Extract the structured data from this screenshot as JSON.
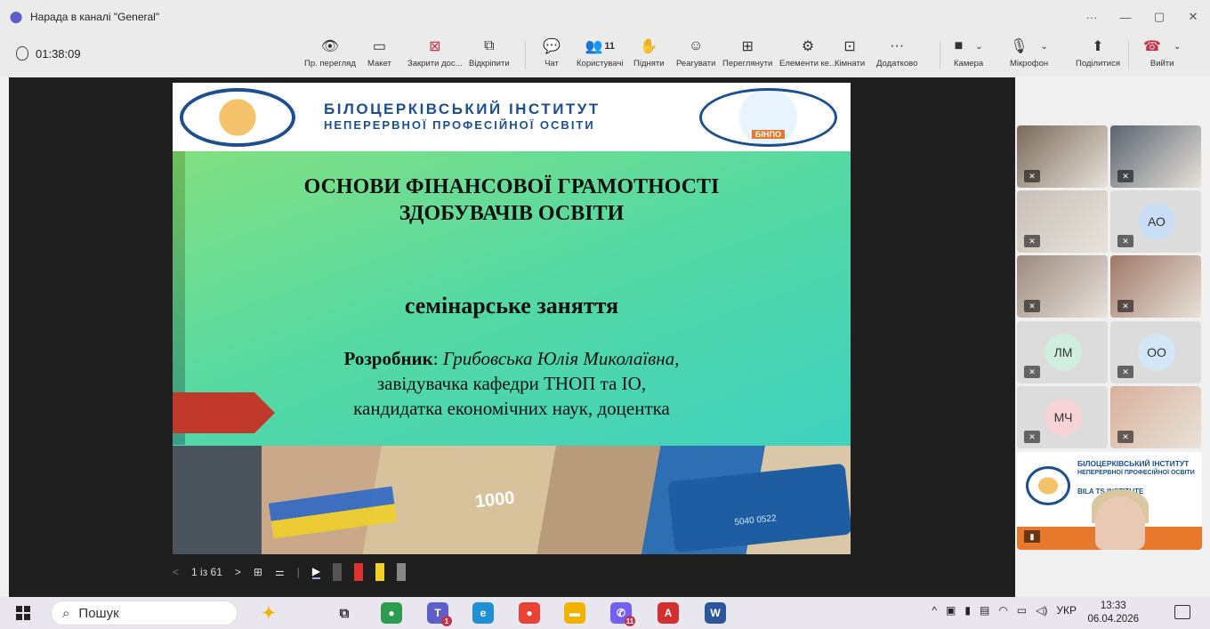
{
  "window": {
    "title": "Нарада в каналі \"General\"",
    "controls": [
      "···",
      "—",
      "▢",
      "✕"
    ]
  },
  "meeting": {
    "timer": "01:38:09"
  },
  "toolbar": {
    "items": [
      {
        "label": "Пр. перегляд",
        "icon": "👁"
      },
      {
        "label": "Макет",
        "icon": "▭"
      },
      {
        "label": "Закрити дос...",
        "icon": "⊠"
      },
      {
        "label": "Відкріпити",
        "icon": "⧉"
      },
      {
        "label": "Чат",
        "icon": "💬"
      },
      {
        "label": "Користувачі",
        "icon": "👥",
        "badge": "11"
      },
      {
        "label": "Підняти",
        "icon": "✋"
      },
      {
        "label": "Реагувати",
        "icon": "☺"
      },
      {
        "label": "Переглянути",
        "icon": "⊞"
      },
      {
        "label": "Елементи ке...",
        "icon": "⚙"
      },
      {
        "label": "Кімнати",
        "icon": "⊡"
      },
      {
        "label": "Додатково",
        "icon": "···"
      }
    ],
    "camera_label": "Камера",
    "mic_label": "Мікрофон",
    "share_label": "Поділитися",
    "leave_label": "Вийти"
  },
  "slide": {
    "header_line1": "БІЛОЦЕРКІВСЬКИЙ ІНСТИТУТ",
    "header_line2": "НЕПЕРЕРВНОЇ ПРОФЕСІЙНОЇ ОСВІТИ",
    "badge": "БІНПО",
    "title_line1": "ОСНОВИ ФІНАНСОВОЇ ГРАМОТНОСТІ",
    "title_line2": "ЗДОБУВАЧІВ ОСВІТИ",
    "subtitle": "семінарське заняття",
    "author_label": "Розробник",
    "author_sep": ": ",
    "author_name": "Грибовська  Юлія Миколаївна,",
    "author_role": "завідувачка кафедри ТНОП та ІО,",
    "author_degree": "кандидатка економічних наук, доцентка",
    "photo_note": "1000",
    "photo_card": "5040 0522"
  },
  "slide_controls": {
    "prev": "<",
    "page": "1 із 61",
    "next": ">"
  },
  "participants": [
    {
      "type": "video",
      "color": "#7a6a5a"
    },
    {
      "type": "video",
      "color": "#5a6470"
    },
    {
      "type": "video",
      "color": "#c8c0b8"
    },
    {
      "type": "initials",
      "initials": "АО",
      "color": "#c9def4"
    },
    {
      "type": "video",
      "color": "#9c8a7e"
    },
    {
      "type": "video",
      "color": "#a07868"
    },
    {
      "type": "initials",
      "initials": "ЛМ",
      "color": "#cfeede"
    },
    {
      "type": "initials",
      "initials": "ОО",
      "color": "#d2e6f7"
    },
    {
      "type": "initials",
      "initials": "МЧ",
      "color": "#f6d3d6"
    },
    {
      "type": "video",
      "color": "#d8b09a"
    }
  ],
  "presenter_tile": {
    "line1": "БІЛОЦЕРКІВСЬКИЙ ІНСТИТУТ",
    "line2": "НЕПЕРЕРВНОЇ ПРОФЕСІЙНОЇ ОСВІТИ",
    "line3": "BILA TS        INSTITUTE"
  },
  "taskbar": {
    "search_placeholder": "Пошук",
    "lang": "УКР",
    "time": "13:33",
    "date": "06.04.2026",
    "badges": {
      "teams": "1",
      "viber": "11"
    }
  }
}
